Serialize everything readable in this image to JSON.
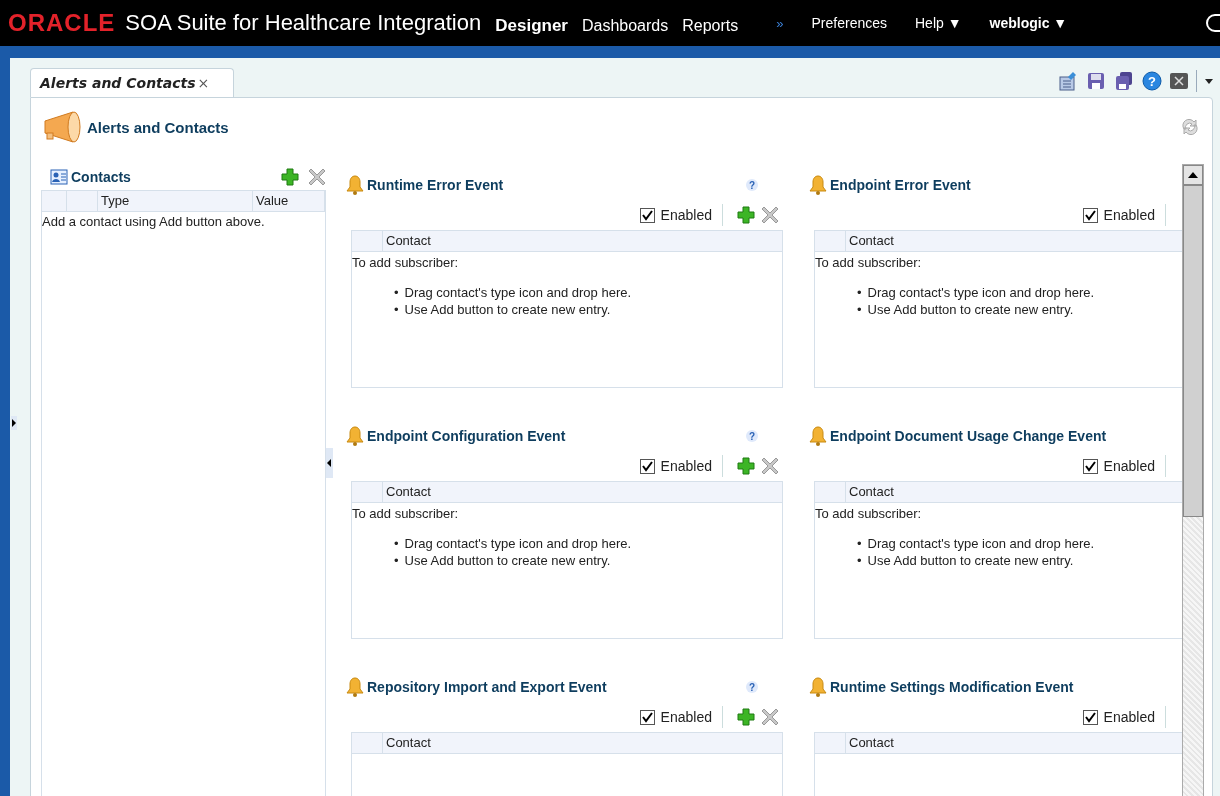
{
  "header": {
    "logo": "ORACLE",
    "product": "SOA Suite for Healthcare Integration",
    "nav": [
      {
        "label": "Designer",
        "selected": true
      },
      {
        "label": "Dashboards",
        "selected": false
      },
      {
        "label": "Reports",
        "selected": false
      }
    ],
    "overflow": "»",
    "menus": [
      {
        "label": "Preferences",
        "kind": "link"
      },
      {
        "label": "Help ▼",
        "kind": "menu"
      },
      {
        "label": "weblogic ▼",
        "kind": "user"
      }
    ]
  },
  "tabs": [
    {
      "label": "Alerts and Contacts",
      "close": "×",
      "selected": true
    }
  ],
  "toolbar": {
    "help": "?"
  },
  "page": {
    "title": "Alerts and Contacts"
  },
  "contacts": {
    "title": "Contacts",
    "columns": [
      "Type",
      "Value"
    ],
    "empty_message": "Add a contact using Add button above."
  },
  "events": [
    {
      "title": "Runtime Error Event",
      "help": "?",
      "enabled": true,
      "enabled_label": "Enabled",
      "actions": true,
      "column": "Contact",
      "hint": "To add subscriber:",
      "bullets": [
        {
          "marker": "•",
          "text": "Drag contact's type icon and drop here."
        },
        {
          "marker": "•",
          "text": "Use Add button to create new entry."
        }
      ]
    },
    {
      "title": "Endpoint Error Event",
      "enabled": true,
      "actions": false,
      "enabled_label": "Enabled",
      "column": "Contact",
      "hint": "To add subscriber:",
      "bullets": [
        {
          "marker": "•",
          "text": "Drag contact's type icon and drop here."
        },
        {
          "marker": "•",
          "text": "Use Add button to create new entry."
        }
      ]
    },
    {
      "title": "Endpoint Configuration Event",
      "help": "?",
      "enabled": true,
      "enabled_label": "Enabled",
      "actions": true,
      "column": "Contact",
      "hint": "To add subscriber:",
      "bullets": [
        {
          "marker": "•",
          "text": "Drag contact's type icon and drop here."
        },
        {
          "marker": "•",
          "text": "Use Add button to create new entry."
        }
      ]
    },
    {
      "title": "Endpoint Document Usage Change Event",
      "enabled": true,
      "actions": false,
      "enabled_label": "Enabled",
      "column": "Contact",
      "hint": "To add subscriber:",
      "bullets": [
        {
          "marker": "•",
          "text": "Drag contact's type icon and drop here."
        },
        {
          "marker": "•",
          "text": "Use Add button to create new entry."
        }
      ]
    },
    {
      "title": "Repository Import and Export Event",
      "help": "?",
      "enabled": true,
      "enabled_label": "Enabled",
      "actions": true,
      "column": "Contact"
    },
    {
      "title": "Runtime Settings Modification Event",
      "enabled": true,
      "actions": false,
      "enabled_label": "Enabled",
      "column": "Contact"
    }
  ]
}
